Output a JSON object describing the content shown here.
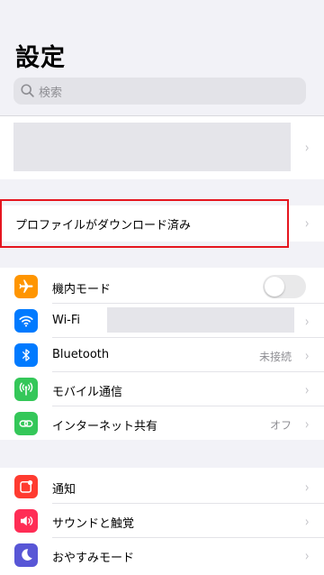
{
  "header": {
    "title": "設定"
  },
  "search": {
    "placeholder": "検索"
  },
  "profile_notice": {
    "label": "プロファイルがダウンロード済み"
  },
  "connectivity": {
    "airplane": {
      "label": "機内モード",
      "toggle_on": false
    },
    "wifi": {
      "label": "Wi-Fi"
    },
    "bluetooth": {
      "label": "Bluetooth",
      "value": "未接続"
    },
    "cellular": {
      "label": "モバイル通信"
    },
    "hotspot": {
      "label": "インターネット共有",
      "value": "オフ"
    }
  },
  "notifications_group": {
    "notifications": {
      "label": "通知"
    },
    "sounds": {
      "label": "サウンドと触覚"
    },
    "dnd": {
      "label": "おやすみモード"
    }
  },
  "chevron": "›",
  "colors": {
    "airplane": "#ff9500",
    "wifi": "#007aff",
    "bluetooth": "#007aff",
    "cellular": "#34c759",
    "hotspot": "#34c759",
    "notifications": "#ff3b30",
    "sounds": "#ff2d55",
    "dnd": "#5856d6",
    "highlight": "#e5161f"
  },
  "icons": [
    "search-icon",
    "airplane-icon",
    "wifi-icon",
    "bluetooth-icon",
    "antenna-icon",
    "hotspot-icon",
    "notification-icon",
    "speaker-icon",
    "moon-icon"
  ]
}
